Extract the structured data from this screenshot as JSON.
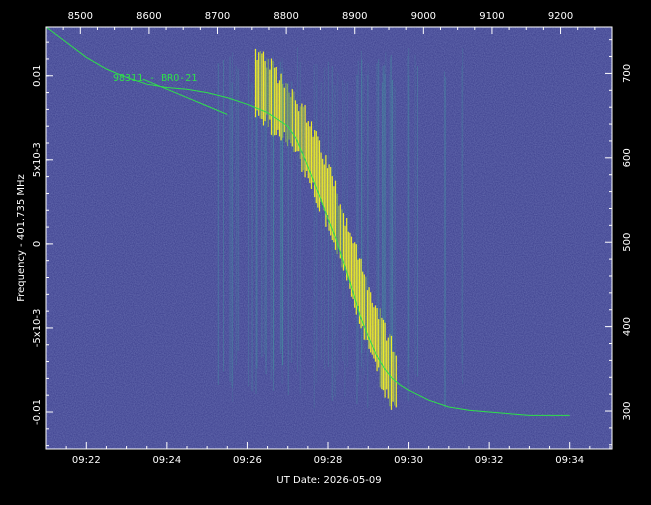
{
  "chart_data": {
    "type": "heatmap",
    "xlabel": "UT Date: 2026-05-09",
    "ylabel": "Frequency - 401.735 MHz",
    "x_bottom_ticks": [
      "09:22",
      "09:24",
      "09:26",
      "09:28",
      "09:30",
      "09:32",
      "09:34"
    ],
    "x_bottom_minutes": [
      22,
      24,
      26,
      28,
      30,
      32,
      34
    ],
    "x_bottom_range_minutes": [
      21.0,
      35.05
    ],
    "x_top_ticks": [
      "8500",
      "8600",
      "8700",
      "8800",
      "8900",
      "9000",
      "9100",
      "9200"
    ],
    "x_top_values": [
      8500,
      8600,
      8700,
      8800,
      8900,
      9000,
      9100,
      9200
    ],
    "x_top_range": [
      8450,
      9275
    ],
    "y_left_ticks": [
      "0.01",
      "5x10-3",
      "0",
      "-5x10-3",
      "-0.01"
    ],
    "y_left_values": [
      0.01,
      0.005,
      0,
      -0.005,
      -0.01
    ],
    "y_left_range": [
      -0.0122,
      0.0129
    ],
    "y_right_ticks": [
      "700",
      "600",
      "500",
      "400",
      "300"
    ],
    "y_right_values": [
      700,
      600,
      500,
      400,
      300
    ],
    "y_right_range": [
      255,
      755
    ],
    "annotation": "98311 - BRO-21",
    "background_color": "#3a3d8c",
    "signal_color": "#f5f224",
    "curve_color": "#2ee04a",
    "curve_minutes": [
      21.0,
      21.5,
      22.0,
      22.5,
      23.0,
      23.5,
      24.0,
      24.5,
      25.0,
      25.5,
      26.0,
      26.5,
      27.0,
      27.2,
      27.4,
      27.6,
      27.8,
      28.0,
      28.2,
      28.4,
      28.6,
      28.8,
      29.0,
      29.2,
      29.4,
      29.6,
      29.8,
      30.0,
      30.5,
      31.0,
      31.5,
      32.0,
      32.5,
      33.0,
      33.5,
      34.0
    ],
    "curve_freq": [
      0.0129,
      0.012,
      0.0111,
      0.0104,
      0.0099,
      0.0095,
      0.0093,
      0.0092,
      0.009,
      0.0087,
      0.0083,
      0.0078,
      0.007,
      0.0063,
      0.0052,
      0.004,
      0.0028,
      0.0015,
      0.0003,
      -0.0012,
      -0.0027,
      -0.0043,
      -0.0055,
      -0.0066,
      -0.0074,
      -0.008,
      -0.0084,
      -0.0087,
      -0.0093,
      -0.0097,
      -0.0099,
      -0.01,
      -0.0101,
      -0.0102,
      -0.0102,
      -0.0102
    ],
    "secondary_curve_minutes": [
      23.4,
      24.0,
      24.5,
      25.0,
      25.5
    ],
    "secondary_curve_freq": [
      0.0098,
      0.0092,
      0.0087,
      0.0082,
      0.0077
    ],
    "signal_band_minutes": [
      26.2,
      26.5,
      26.8,
      27.1,
      27.4,
      27.7,
      28.0,
      28.3,
      28.6,
      28.9,
      29.2,
      29.5,
      29.7
    ],
    "signal_band_center_freq": [
      0.0096,
      0.009,
      0.0082,
      0.0074,
      0.0062,
      0.0046,
      0.003,
      0.0008,
      -0.0014,
      -0.0036,
      -0.0056,
      -0.0074,
      -0.0082
    ]
  }
}
